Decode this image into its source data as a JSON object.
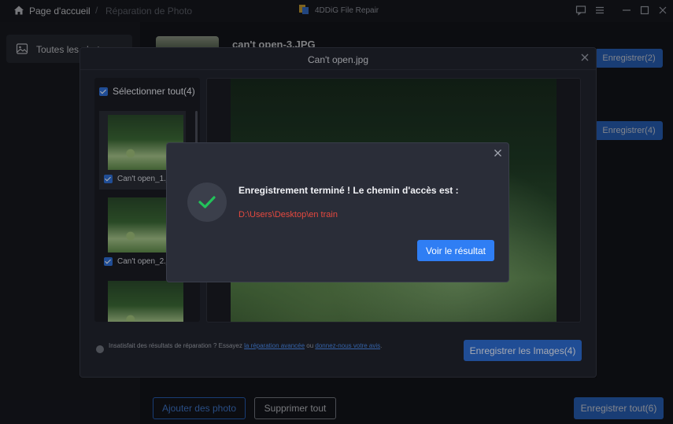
{
  "titlebar": {
    "home_label": "Page d'accueil",
    "separator": "/",
    "current_label": "Réparation de Photo",
    "app_title": "4DDiG File Repair"
  },
  "sidebar": {
    "items": [
      {
        "label": "Toutes les photos"
      }
    ]
  },
  "main": {
    "file_name": "can't open-3.JPG",
    "save_buttons": [
      "Enregistrer(2)",
      "Enregistrer(4)"
    ],
    "bottom": {
      "add_label": "Ajouter des photo",
      "delete_label": "Supprimer tout",
      "save_all_label": "Enregistrer tout(6)"
    }
  },
  "preview_modal": {
    "title": "Can't open.jpg",
    "select_all_label": "Sélectionner tout(4)",
    "thumbnails": [
      {
        "label": "Can't open_1.jpg"
      },
      {
        "label": "Can't open_2.jpg"
      }
    ],
    "footer": {
      "text_before": "Insatisfait des résultats de réparation ? Essayez ",
      "link1": "la réparation avancée",
      "text_middle": " ou ",
      "link2": "donnez-nous votre avis",
      "text_after": "."
    },
    "save_images_label": "Enregistrer les Images(4)"
  },
  "success_dialog": {
    "title": "Enregistrement terminé ! Le chemin d'accès est :",
    "path": "D:\\Users\\Desktop\\en train",
    "view_result_label": "Voir le résultat"
  },
  "colors": {
    "accent": "#2f6fd6",
    "path_red": "#e6493f",
    "success_green": "#22c25a"
  }
}
